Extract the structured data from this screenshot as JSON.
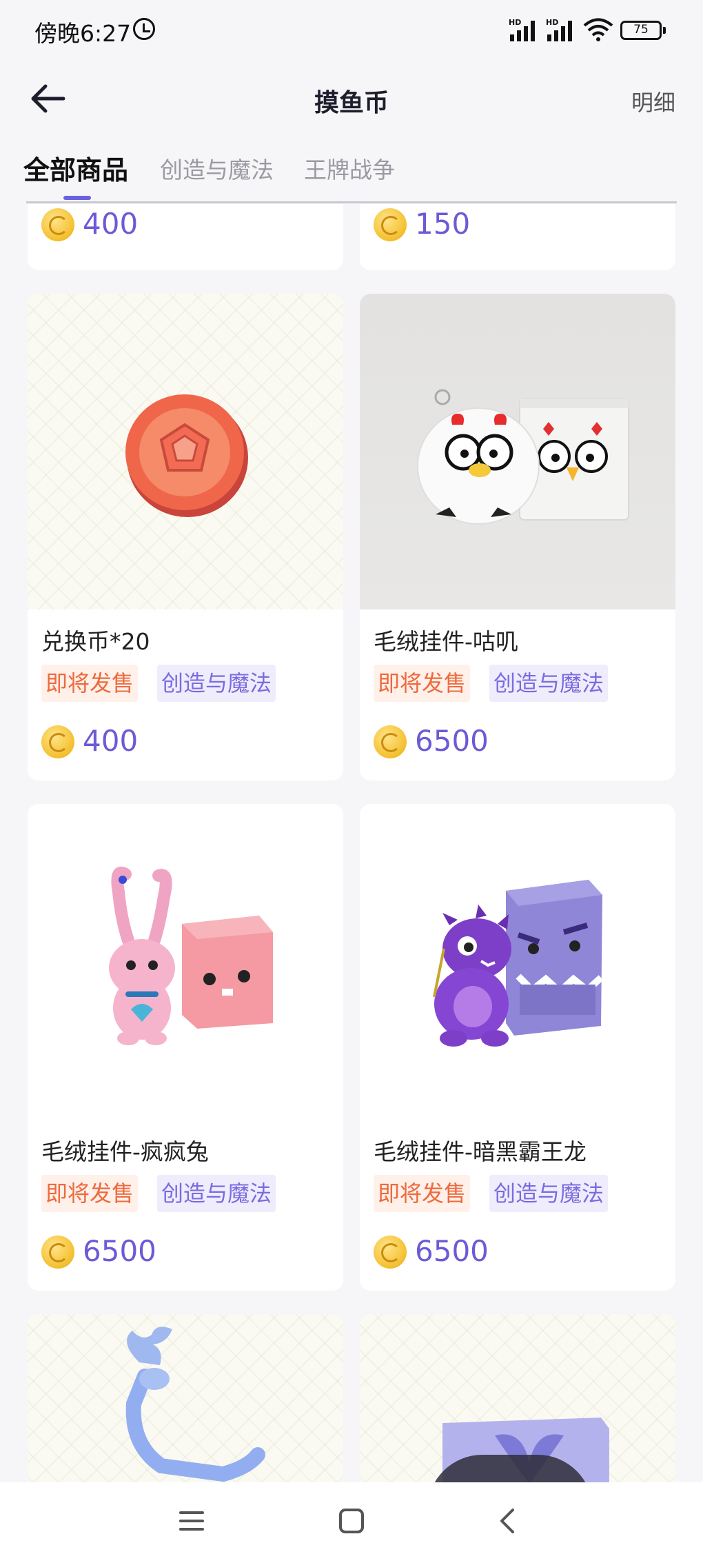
{
  "status_bar": {
    "time": "傍晚6:27",
    "battery": "75",
    "network_1": "HD",
    "network_2": "HD"
  },
  "header": {
    "title": "摸鱼币",
    "detail": "明细"
  },
  "tabs": [
    {
      "label": "全部商品",
      "active": true
    },
    {
      "label": "创造与魔法",
      "active": false
    },
    {
      "label": "王牌战争",
      "active": false
    }
  ],
  "top_prices": [
    "400",
    "150"
  ],
  "products": [
    {
      "name": "兑换币*20",
      "status": "即将发售",
      "category": "创造与魔法",
      "price": "400",
      "image": "coin-gem-image"
    },
    {
      "name": "毛绒挂件-咕叽",
      "status": "即将发售",
      "category": "创造与魔法",
      "price": "6500",
      "image": "chick-plush-image"
    },
    {
      "name": "毛绒挂件-疯疯兔",
      "status": "即将发售",
      "category": "创造与魔法",
      "price": "6500",
      "image": "rabbit-plush-image"
    },
    {
      "name": "毛绒挂件-暗黑霸王龙",
      "status": "即将发售",
      "category": "创造与魔法",
      "price": "6500",
      "image": "dragon-plush-image"
    }
  ],
  "colors": {
    "accent": "#6c62e0",
    "price": "#6c5ad6",
    "sale_tag": "#ee6a3c",
    "category_tag": "#7a6be0",
    "coin": "#f4bf2e"
  },
  "icons": [
    "back-arrow-icon",
    "alarm-icon",
    "wifi-icon",
    "battery-icon",
    "coin-icon",
    "menu-icon",
    "home-icon",
    "nav-back-icon"
  ]
}
